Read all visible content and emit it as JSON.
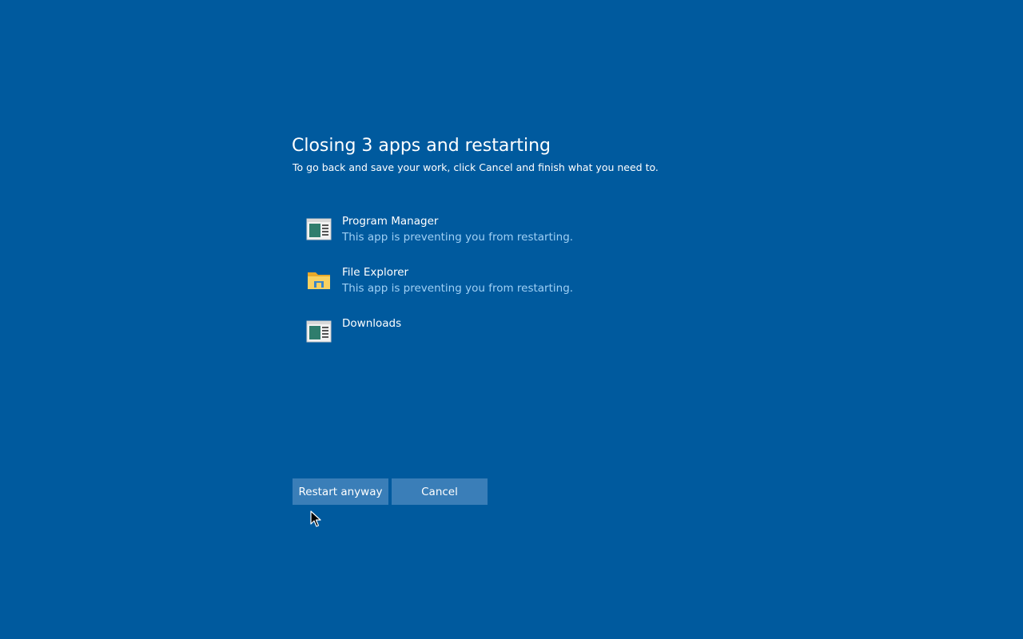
{
  "header": {
    "title": "Closing 3 apps and restarting",
    "subtitle": "To go back and save your work, click Cancel and finish what you need to."
  },
  "apps": [
    {
      "name": "Program Manager",
      "status": "This app is preventing you from restarting.",
      "icon": "program-manager-icon"
    },
    {
      "name": "File Explorer",
      "status": "This app is preventing you from restarting.",
      "icon": "folder-icon"
    },
    {
      "name": "Downloads",
      "status": "",
      "icon": "window-icon"
    }
  ],
  "buttons": {
    "restart_label": "Restart anyway",
    "cancel_label": "Cancel"
  },
  "colors": {
    "background": "#005a9e",
    "button": "#3a7eb8",
    "status_text": "#9fd0f5"
  }
}
